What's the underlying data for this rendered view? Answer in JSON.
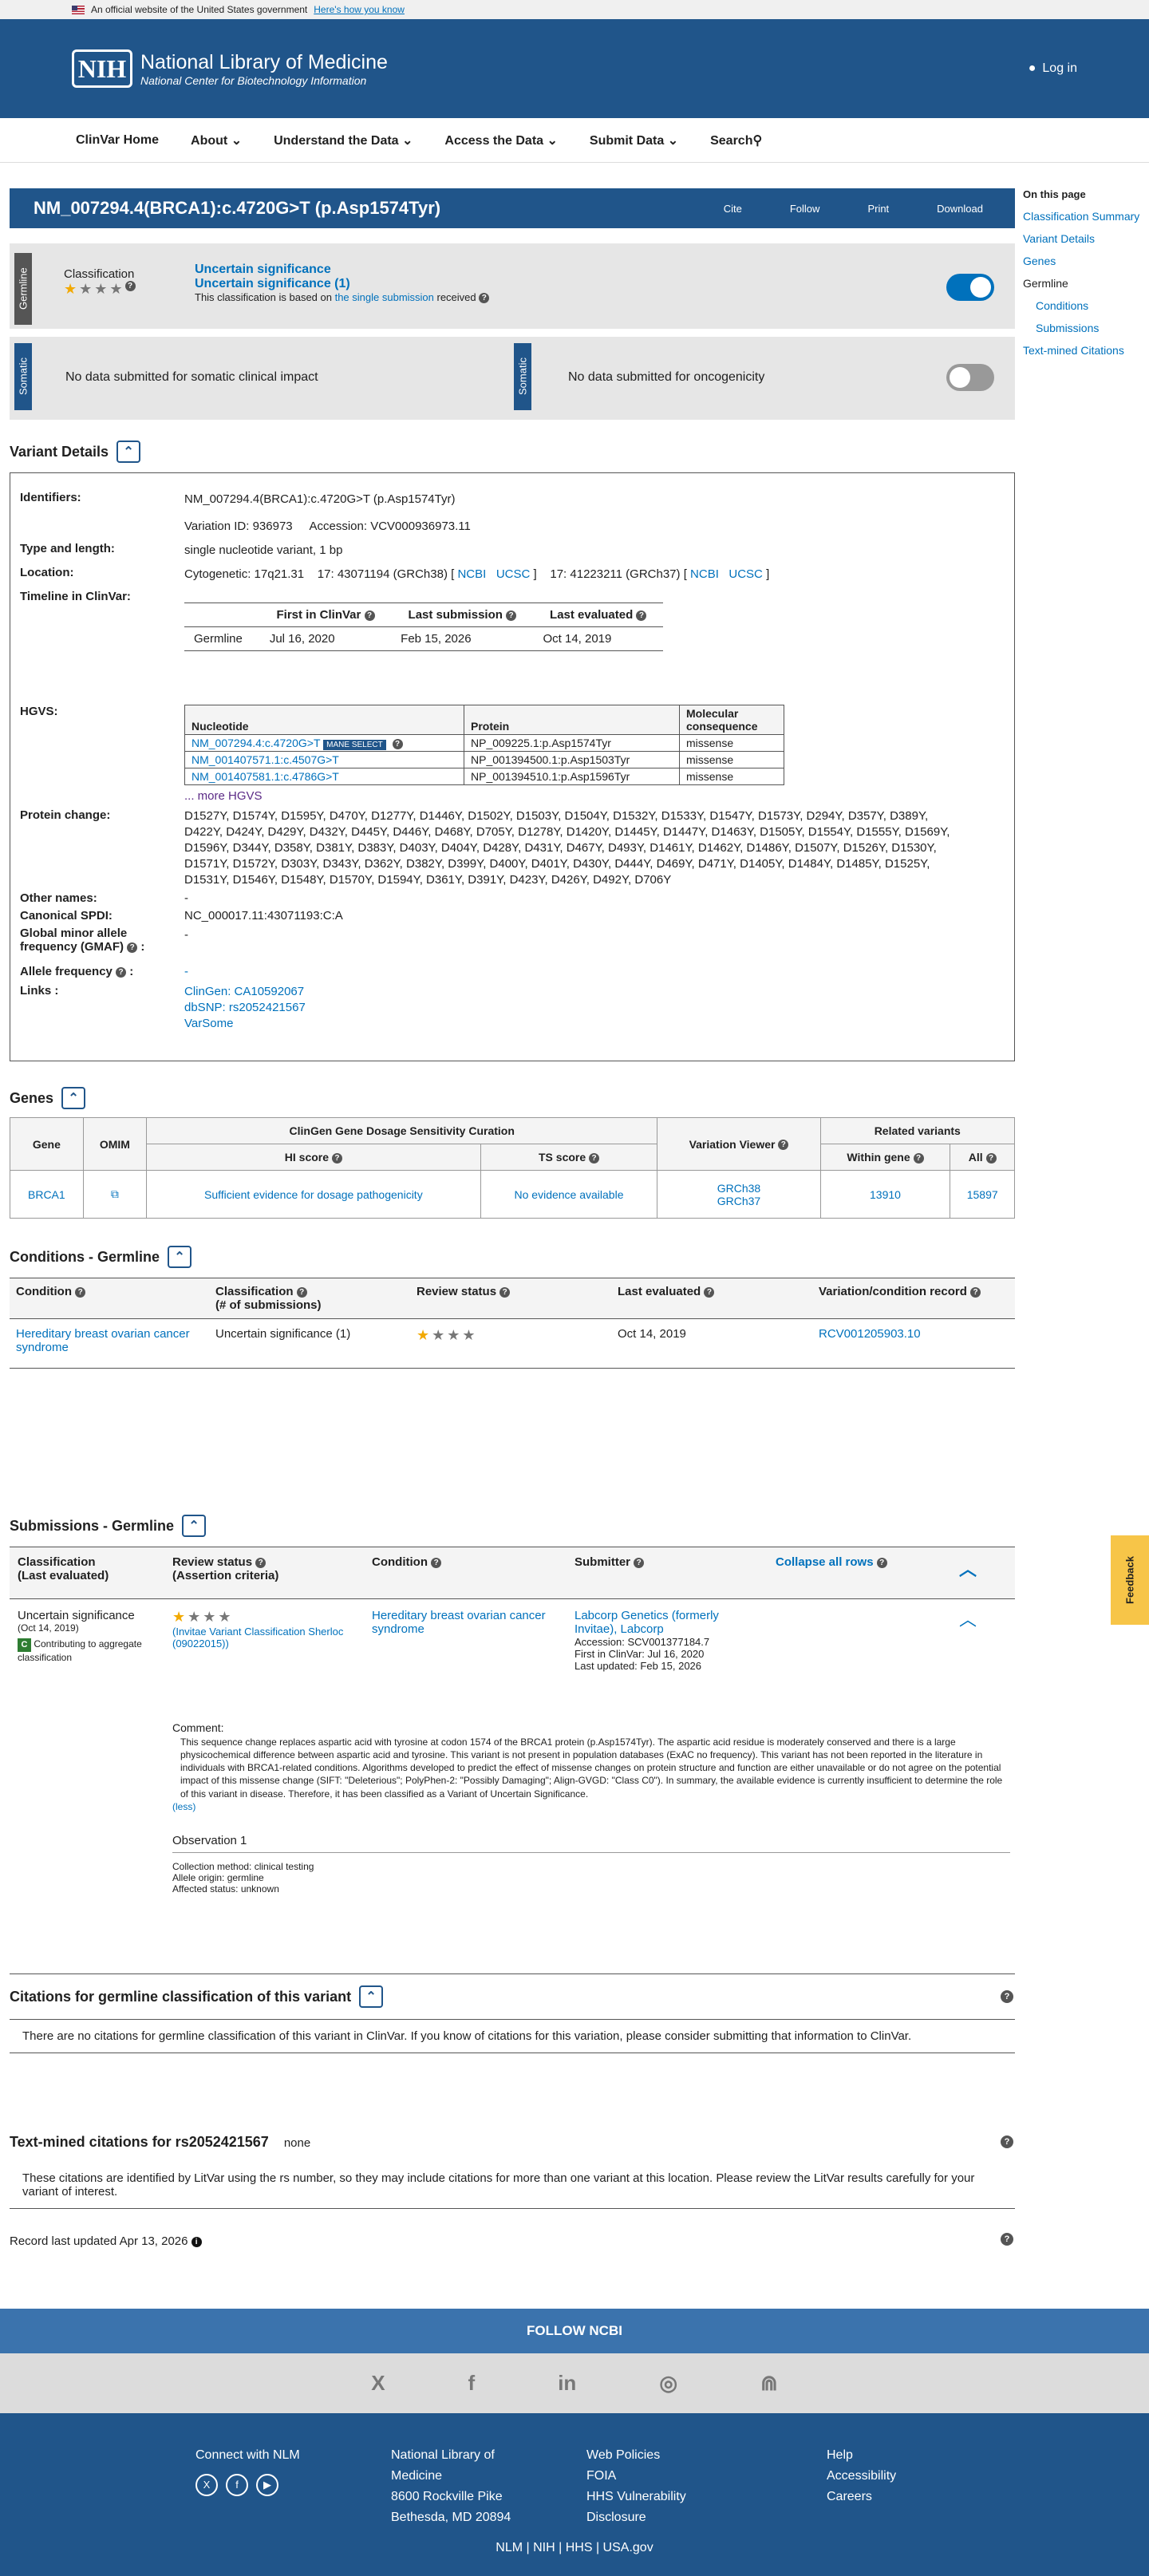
{
  "gov": {
    "text": "An official website of the United States government",
    "link": "Here's how you know"
  },
  "header": {
    "logo": "NIH",
    "title": "National Library of Medicine",
    "subtitle": "National Center for Biotechnology Information",
    "login": "Log in"
  },
  "nav": [
    "ClinVar Home",
    "About",
    "Understand the Data",
    "Access the Data",
    "Submit Data",
    "Search"
  ],
  "title": "NM_007294.4(BRCA1):c.4720G>T (p.Asp1574Tyr)",
  "actions": [
    "Cite",
    "Follow",
    "Print",
    "Download"
  ],
  "on_this_page": {
    "heading": "On this page",
    "items": [
      "Classification Summary",
      "Variant Details",
      "Genes",
      "Germline",
      "Conditions",
      "Submissions",
      "Text-mined Citations"
    ]
  },
  "germline": {
    "tab": "Germline",
    "label": "Classification",
    "class1": "Uncertain significance",
    "class2": "Uncertain significance (1)",
    "basis_pre": "This classification is based on ",
    "basis_link": "the single submission",
    "basis_post": " received"
  },
  "somatic": {
    "tab": "Somatic",
    "clinical": "No data submitted for somatic clinical impact",
    "onco": "No data submitted for oncogenicity"
  },
  "variant": {
    "heading": "Variant Details",
    "identifiers_l": "Identifiers:",
    "identifiers": "NM_007294.4(BRCA1):c.4720G>T (p.Asp1574Tyr)",
    "variation_id": "Variation ID: 936973",
    "accession": "Accession: VCV000936973.11",
    "type_l": "Type and length:",
    "type": "single nucleotide variant, 1 bp",
    "location_l": "Location:",
    "cyto": "Cytogenetic: 17q21.31",
    "grch38": "17: 43071194 (GRCh38) [",
    "grch37": "17: 41223211 (GRCh37) [",
    "ncbi": "NCBI",
    "ucsc": "UCSC",
    "close": "]",
    "timeline_l": "Timeline in ClinVar:",
    "tl_heads": [
      "First in ClinVar",
      "Last submission",
      "Last evaluated"
    ],
    "tl_row": [
      "Germline",
      "Jul 16, 2020",
      "Feb 15, 2026",
      "Oct 14, 2019"
    ],
    "hgvs_l": "HGVS:",
    "hgvs_heads": [
      "Nucleotide",
      "Protein",
      "Molecular consequence"
    ],
    "hgvs": [
      {
        "n": "NM_007294.4:c.4720G>T",
        "p": "NP_009225.1:p.Asp1574Tyr",
        "m": "missense",
        "mane": "MANE SELECT"
      },
      {
        "n": "NM_001407571.1:c.4507G>T",
        "p": "NP_001394500.1:p.Asp1503Tyr",
        "m": "missense"
      },
      {
        "n": "NM_001407581.1:c.4786G>T",
        "p": "NP_001394510.1:p.Asp1596Tyr",
        "m": "missense"
      }
    ],
    "more_hgvs": "... more HGVS",
    "protein_l": "Protein change:",
    "protein": "D1527Y, D1574Y, D1595Y, D470Y, D1277Y, D1446Y, D1502Y, D1503Y, D1504Y, D1532Y, D1533Y, D1547Y, D1573Y, D294Y, D357Y, D389Y, D422Y, D424Y, D429Y, D432Y, D445Y, D446Y, D468Y, D705Y, D1278Y, D1420Y, D1445Y, D1447Y, D1463Y, D1505Y, D1554Y, D1555Y, D1569Y, D1596Y, D344Y, D358Y, D381Y, D383Y, D403Y, D404Y, D428Y, D431Y, D467Y, D493Y, D1461Y, D1462Y, D1486Y, D1507Y, D1526Y, D1530Y, D1571Y, D1572Y, D303Y, D343Y, D362Y, D382Y, D399Y, D400Y, D401Y, D430Y, D444Y, D469Y, D471Y, D1405Y, D1484Y, D1485Y, D1525Y, D1531Y, D1546Y, D1548Y, D1570Y, D1594Y, D361Y, D391Y, D423Y, D426Y, D492Y, D706Y",
    "other_l": "Other names:",
    "other": "-",
    "spdi_l": "Canonical SPDI:",
    "spdi": "NC_000017.11:43071193:C:A",
    "gmaf_l": "Global minor allele frequency (GMAF)",
    "gmaf": "-",
    "af_l": "Allele frequency",
    "af": "-",
    "links_l": "Links :",
    "links": [
      "ClinGen: CA10592067",
      "dbSNP: rs2052421567",
      "VarSome"
    ]
  },
  "genes": {
    "heading": "Genes",
    "heads": [
      "Gene",
      "OMIM",
      "ClinGen Gene Dosage Sensitivity Curation",
      "Variation Viewer",
      "Related variants",
      "HI score",
      "TS score",
      "Within gene",
      "All"
    ],
    "row": {
      "gene": "BRCA1",
      "hi": "Sufficient evidence for dosage pathogenicity",
      "ts": "No evidence available",
      "v1": "GRCh38",
      "v2": "GRCh37",
      "within": "13910",
      "all": "15897"
    }
  },
  "conditions": {
    "heading": "Conditions - Germline",
    "heads": [
      "Condition",
      "Classification",
      "(# of submissions)",
      "Review status",
      "Last evaluated",
      "Variation/condition record"
    ],
    "row": {
      "cond": "Hereditary breast ovarian cancer syndrome",
      "cls": "Uncertain significance (1)",
      "eval": "Oct 14, 2019",
      "rcv": "RCV001205903.10"
    }
  },
  "submissions": {
    "heading": "Submissions - Germline",
    "heads": [
      "Classification",
      "(Last evaluated)",
      "Review status",
      "(Assertion criteria)",
      "Condition",
      "Submitter",
      "Collapse all rows"
    ],
    "cls": "Uncertain significance",
    "date": "(Oct 14, 2019)",
    "contrib": "Contributing to aggregate classification",
    "badge": "C",
    "criteria": "(Invitae Variant Classification Sherloc (09022015))",
    "cond": "Hereditary breast ovarian cancer syndrome",
    "submitter": "Labcorp Genetics (formerly Invitae), Labcorp",
    "acc": "Accession: SCV001377184.7",
    "first": "First in ClinVar: Jul 16, 2020",
    "updated": "Last updated: Feb 15, 2026",
    "comment_l": "Comment:",
    "comment": "This sequence change replaces aspartic acid with tyrosine at codon 1574 of the BRCA1 protein (p.Asp1574Tyr). The aspartic acid residue is moderately conserved and there is a large physicochemical difference between aspartic acid and tyrosine. This variant is not present in population databases (ExAC no frequency). This variant has not been reported in the literature in individuals with BRCA1-related conditions. Algorithms developed to predict the effect of missense changes on protein structure and function are either unavailable or do not agree on the potential impact of this missense change (SIFT: \"Deleterious\"; PolyPhen-2: \"Possibly Damaging\"; Align-GVGD: \"Class C0\"). In summary, the available evidence is currently insufficient to determine the role of this variant in disease. Therefore, it has been classified as a Variant of Uncertain Significance.",
    "less": "(less)",
    "obs": "Observation 1",
    "method": "Collection method: clinical testing",
    "origin": "Allele origin: germline",
    "status": "Affected status: unknown"
  },
  "citations": {
    "heading": "Citations for germline classification of this variant",
    "text": "There are no citations for germline classification of this variant in ClinVar. If you know of citations for this variation, please consider submitting that information to ClinVar."
  },
  "textmined": {
    "heading": "Text-mined citations for rs2052421567",
    "none": "none",
    "text": "These citations are identified by LitVar using the rs number, so they may include citations for more than one variant at this location. Please review the LitVar results carefully for your variant of interest."
  },
  "record": "Record last updated Apr 13, 2026",
  "feedback": "Feedback",
  "footer": {
    "follow": "FOLLOW NCBI",
    "social": [
      "X",
      "f",
      "in",
      "◎",
      "⋒"
    ],
    "connect": "Connect with NLM",
    "nlm": [
      "National Library of",
      "Medicine",
      "8600 Rockville Pike",
      "Bethesda, MD 20894"
    ],
    "policies": [
      "Web Policies",
      "FOIA",
      "HHS Vulnerability",
      "Disclosure"
    ],
    "help": [
      "Help",
      "Accessibility",
      "Careers"
    ],
    "bottom": "NLM | NIH | HHS | USA.gov"
  }
}
